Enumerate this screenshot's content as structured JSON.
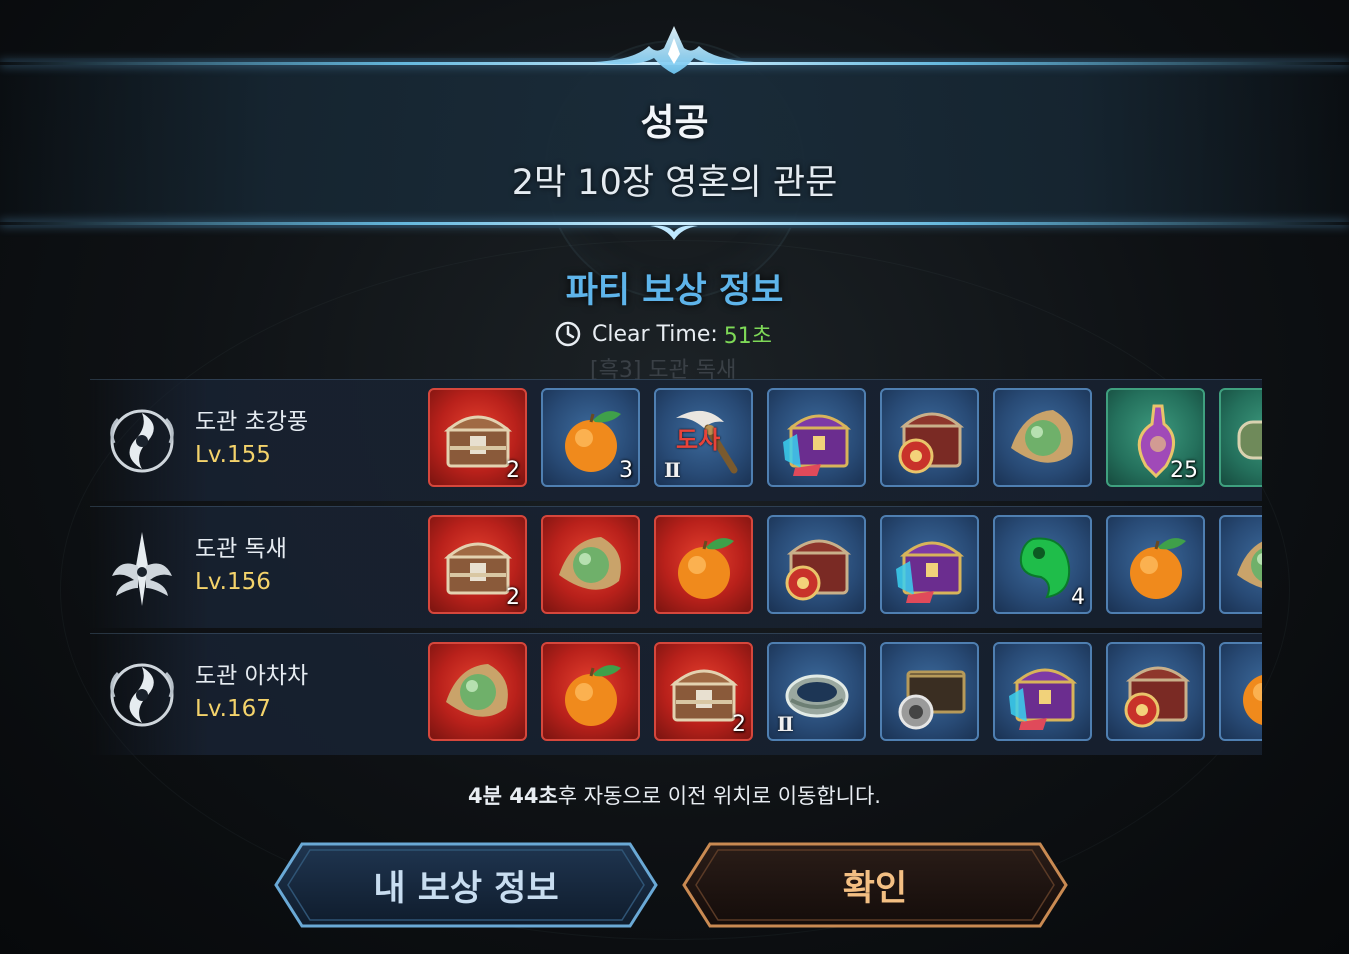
{
  "header": {
    "result": "성공",
    "stage": "2막 10장 영혼의 관문"
  },
  "reward": {
    "title": "파티 보상 정보",
    "clear_label": "Clear Time:",
    "clear_value": "51초",
    "ghost_text": "[흑3] 도관 독새"
  },
  "party": [
    {
      "name": "도관 초강풍",
      "level": "Lv.155",
      "emblem": "swirl-crest-icon",
      "items": [
        {
          "icon": "treasure-chest-icon",
          "bg": "red",
          "count": "2"
        },
        {
          "icon": "orange-fruit-icon",
          "bg": "blue",
          "count": "3"
        },
        {
          "icon": "horn-staff-icon",
          "bg": "blue",
          "grade": "Ⅱ",
          "tag": "도사"
        },
        {
          "icon": "purple-chest-icon",
          "bg": "blue"
        },
        {
          "icon": "red-chest-icon",
          "bg": "blue"
        },
        {
          "icon": "jade-pearl-icon",
          "bg": "blue"
        },
        {
          "icon": "potion-flask-icon",
          "bg": "green",
          "count": "25"
        },
        {
          "icon": "scroll-icon",
          "bg": "green"
        }
      ]
    },
    {
      "name": "도관 독새",
      "level": "Lv.156",
      "emblem": "wing-crest-icon",
      "items": [
        {
          "icon": "treasure-chest-icon",
          "bg": "red",
          "count": "2"
        },
        {
          "icon": "jade-pearl-icon",
          "bg": "red"
        },
        {
          "icon": "orange-fruit-icon",
          "bg": "red"
        },
        {
          "icon": "red-chest-icon",
          "bg": "blue"
        },
        {
          "icon": "purple-chest-icon",
          "bg": "blue"
        },
        {
          "icon": "green-magatama-icon",
          "bg": "blue",
          "count": "4"
        },
        {
          "icon": "orange-fruit-icon",
          "bg": "blue"
        },
        {
          "icon": "jade-pearl-icon",
          "bg": "blue"
        }
      ]
    },
    {
      "name": "도관 아차차",
      "level": "Lv.167",
      "emblem": "swirl-crest-icon",
      "items": [
        {
          "icon": "jade-pearl-icon",
          "bg": "red"
        },
        {
          "icon": "orange-fruit-icon",
          "bg": "red"
        },
        {
          "icon": "treasure-chest-icon",
          "bg": "red",
          "count": "2"
        },
        {
          "icon": "jade-ring-icon",
          "bg": "blue",
          "grade": "Ⅱ"
        },
        {
          "icon": "coin-chest-icon",
          "bg": "blue"
        },
        {
          "icon": "purple-chest-icon",
          "bg": "blue"
        },
        {
          "icon": "red-chest-icon",
          "bg": "blue"
        },
        {
          "icon": "orange-fruit-icon",
          "bg": "blue"
        }
      ]
    }
  ],
  "footer": {
    "timer_bold": "4분 44초",
    "timer_rest": "후 자동으로 이전 위치로 이동합니다.",
    "my_reward_label": "내 보상 정보",
    "confirm_label": "확인"
  },
  "colors": {
    "accent_blue": "#5eb4ea",
    "clear_green": "#7ed957",
    "level_gold": "#f4d36b",
    "confirm_text": "#f3bf83"
  }
}
